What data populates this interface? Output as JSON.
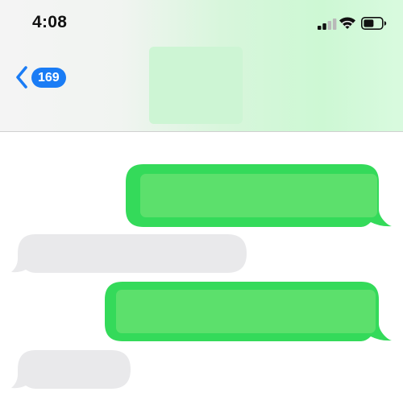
{
  "status_bar": {
    "time": "4:08",
    "signal_icon": "cellular-signal-icon",
    "wifi_icon": "wifi-icon",
    "battery_icon": "battery-icon"
  },
  "nav": {
    "back_icon": "chevron-left-icon",
    "unread_count": "169"
  },
  "colors": {
    "accent_blue": "#1a7cf5",
    "sent_outer": "#34da5a",
    "sent_inner": "#5ce06c",
    "received": "#e9e9eb"
  }
}
